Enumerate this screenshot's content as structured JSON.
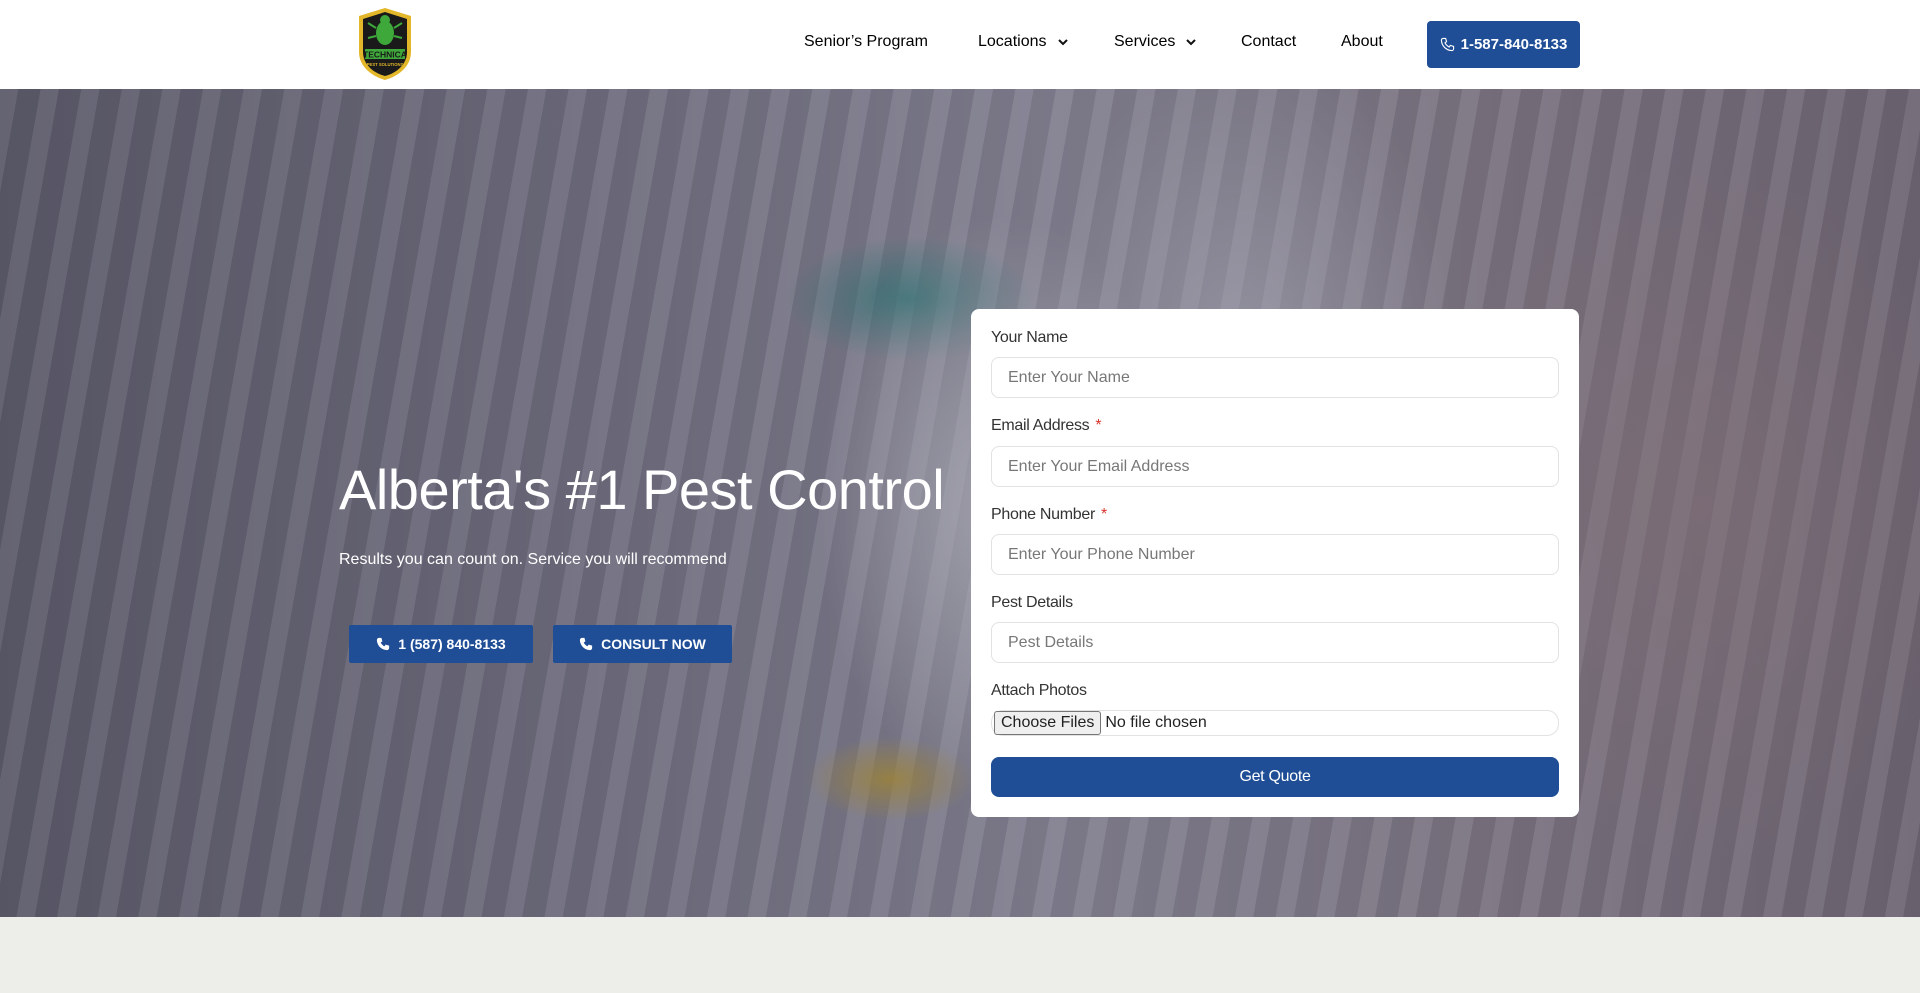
{
  "header": {
    "logo": {
      "text": "TECHNICA",
      "subtext": "PEST SOLUTIONS",
      "colors": {
        "shield": "#1a1a1a",
        "rim": "#e3b72a",
        "bug": "#3ea83a"
      }
    },
    "nav": [
      {
        "label": "Senior’s Program",
        "dropdown": false
      },
      {
        "label": "Locations",
        "dropdown": true,
        "icon": "chevron-down-icon"
      },
      {
        "label": "Services",
        "dropdown": true,
        "icon": "chevron-down-icon"
      },
      {
        "label": "Contact",
        "dropdown": false
      },
      {
        "label": "About",
        "dropdown": false
      }
    ],
    "phone_button": {
      "label": "1-587-840-8133",
      "icon": "phone-icon"
    }
  },
  "hero": {
    "title": "Alberta's #1 Pest Control",
    "subtitle": "Results you can count on. Service you will recommend",
    "buttons": [
      {
        "label": "1 (587) 840-8133",
        "icon": "phone-icon"
      },
      {
        "label": "CONSULT NOW",
        "icon": "phone-icon"
      }
    ]
  },
  "form": {
    "fields": [
      {
        "label": "Your Name",
        "required": false,
        "placeholder": "Enter Your Name",
        "value": ""
      },
      {
        "label": "Email Address",
        "required": true,
        "placeholder": "Enter Your Email Address",
        "value": ""
      },
      {
        "label": "Phone Number",
        "required": true,
        "placeholder": "Enter Your Phone Number",
        "value": ""
      },
      {
        "label": "Pest Details",
        "required": false,
        "placeholder": "Pest Details",
        "value": ""
      }
    ],
    "required_mark": "*",
    "attach": {
      "label": "Attach Photos",
      "button": "Choose Files",
      "status": "No file chosen"
    },
    "submit": "Get Quote"
  },
  "colors": {
    "primary": "#1f4e96",
    "required": "#d9342b",
    "page_bg": "#ededea"
  }
}
